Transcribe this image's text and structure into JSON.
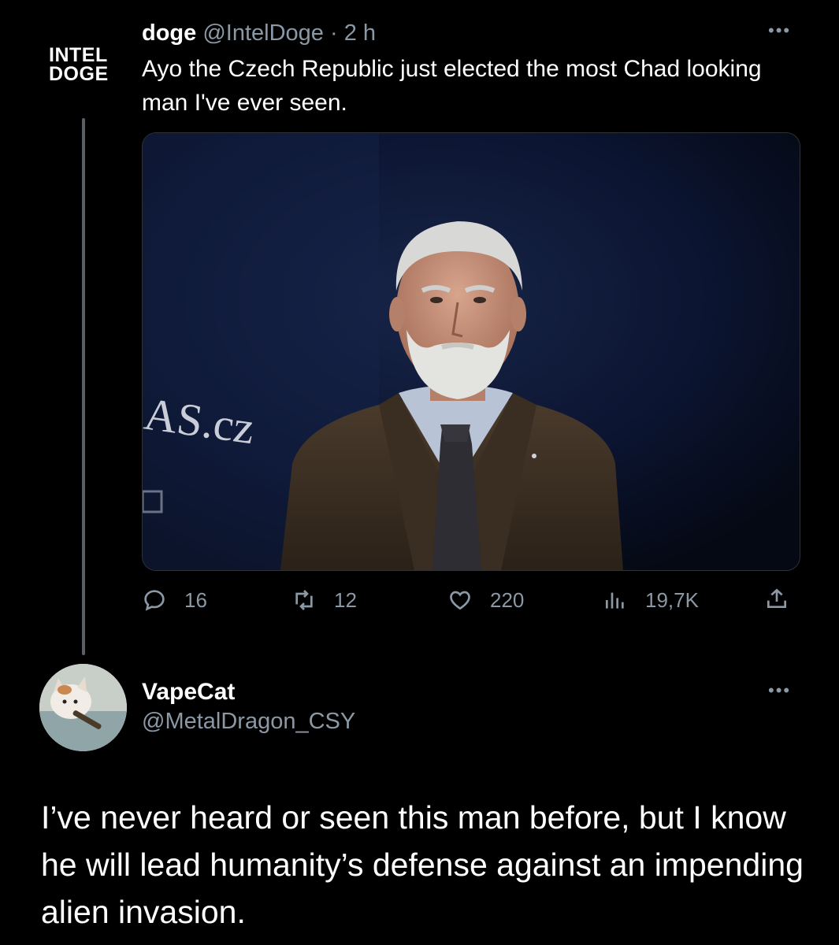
{
  "tweet1": {
    "logo_line1": "INTEL",
    "logo_line2": "DOGE",
    "name": "doge",
    "handle": "@IntelDoge",
    "separator": "·",
    "time": "2 h",
    "text": "Ayo the Czech Republic just elected the most Chad looking man I've ever seen.",
    "more_label": "•••",
    "photo_sign_text": "AS.cz",
    "stats": {
      "replies": "16",
      "retweets": "12",
      "likes": "220",
      "views": "19,7K"
    }
  },
  "tweet2": {
    "name": "VapeCat",
    "handle": "@MetalDragon_CSY",
    "more_label": "•••",
    "text": "I’ve never heard or seen this man before, but I know he will lead humanity’s defense against an impending alien invasion."
  },
  "colors": {
    "background": "#000000",
    "text": "#ffffff",
    "secondary": "#8b98a5",
    "border": "#2f3336"
  }
}
